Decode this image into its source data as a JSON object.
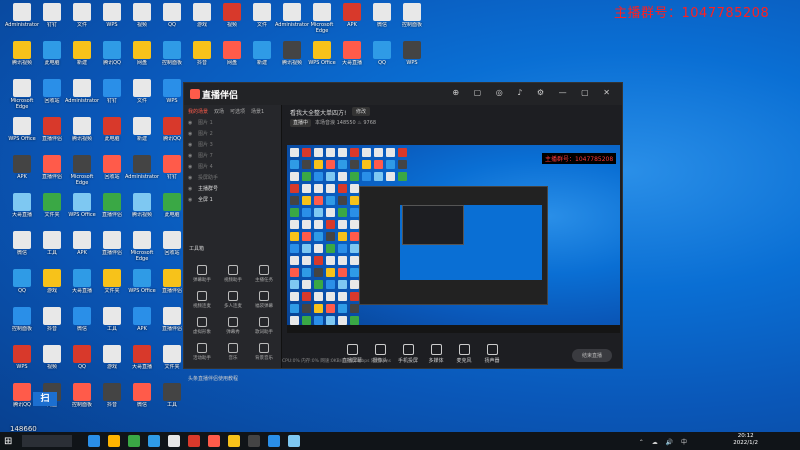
{
  "overlay": {
    "text": "主播群号：1047785208"
  },
  "app": {
    "name": "直播伴侣",
    "tabs": [
      "我的场景",
      "双场",
      "可选项",
      "场景1"
    ],
    "scenes": [
      {
        "label": "图片 1",
        "on": false
      },
      {
        "label": "图片 2",
        "on": false
      },
      {
        "label": "图片 3",
        "on": false
      },
      {
        "label": "图片 7",
        "on": false
      },
      {
        "label": "图片 4",
        "on": false
      },
      {
        "label": "投屏助手",
        "on": false
      },
      {
        "label": "主播群号",
        "on": true
      },
      {
        "label": "全屏 1",
        "on": true
      }
    ],
    "tools_title": "工具箱",
    "tools": [
      "弹幕助手",
      "视频助手",
      "主播任务",
      "视频连麦",
      "多人连麦",
      "福袋弹幕",
      "虚拟形象",
      "弹幕秀",
      "歌词助手",
      "活动助手",
      "音乐",
      "背景音乐"
    ],
    "notice": "头条直播伴侣使用教程",
    "room_title": "看我大全整大单四方!",
    "room_edit": "修改",
    "room_badge": "直播中",
    "room_stats": "本场音浪 148550  ♨ 9768",
    "preview_overlay": "主播群号：1047785208",
    "bottom_buttons": [
      "直播屏幕",
      "摄像头",
      "手机投屏",
      "多媒体",
      "麦克风",
      "扬声器"
    ],
    "golive": "结束直播",
    "status": "CPU:0%  内存:0%  网速:0KB/s  码率:0Kbps  延迟:0ms"
  },
  "taskbar": {
    "time": "20:12",
    "date": "2022/1/2",
    "counter": "148660"
  },
  "desktop_icons": [
    "Administrator",
    "腾讯视频",
    "Microsoft Edge",
    "WPS Office",
    "APK",
    "大哥直播",
    "微信",
    "QQ",
    "控制面板",
    "WPS",
    "腾讯QQ",
    "钉钉",
    "此电脑",
    "回收站",
    "直播伴侣",
    "直播伴侣",
    "文件夹",
    "工具",
    "游戏",
    "抖音",
    "视频",
    "网盘",
    "文件",
    "新建"
  ]
}
